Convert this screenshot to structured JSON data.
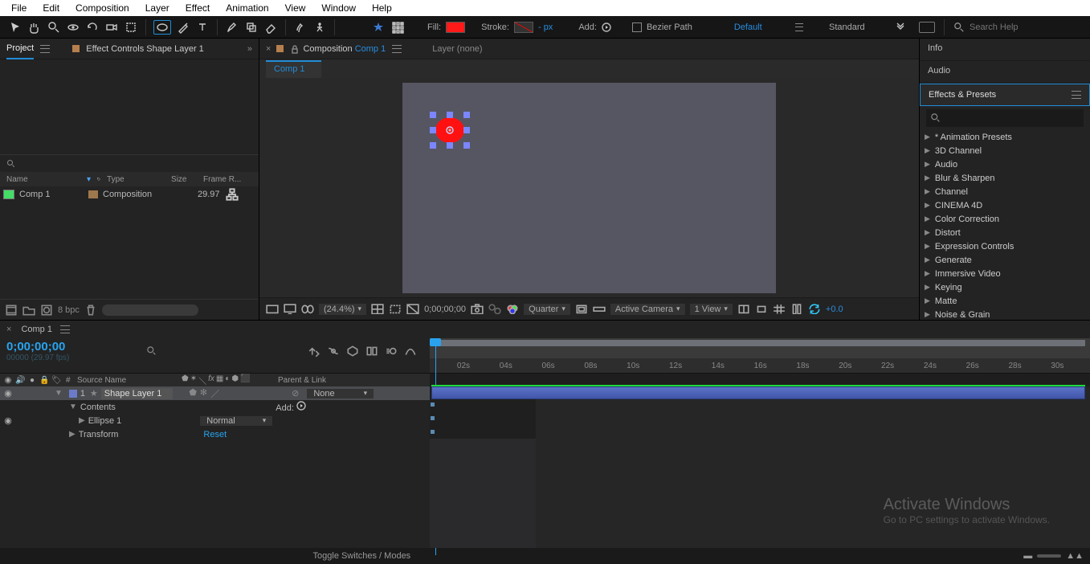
{
  "menubar": [
    "File",
    "Edit",
    "Composition",
    "Layer",
    "Effect",
    "Animation",
    "View",
    "Window",
    "Help"
  ],
  "toolbar": {
    "fill_label": "Fill:",
    "fill_color": "#ff1a1a",
    "stroke_label": "Stroke:",
    "stroke_px": "- px",
    "add_label": "Add:",
    "bezier_label": "Bezier Path",
    "workspace": "Default",
    "layout": "Standard",
    "search_placeholder": "Search Help"
  },
  "project_panel": {
    "title": "Project",
    "fx_tab": "Effect Controls Shape Layer 1",
    "columns": {
      "name": "Name",
      "type": "Type",
      "size": "Size",
      "frame": "Frame R..."
    },
    "item": {
      "name": "Comp 1",
      "type": "Composition",
      "fps": "29.97"
    },
    "bpc": "8 bpc"
  },
  "comp_panel": {
    "title": "Composition",
    "active": "Comp 1",
    "layer_tab": "Layer (none)",
    "tabitem": "Comp 1",
    "footer": {
      "zoom": "(24.4%)",
      "time": "0;00;00;00",
      "quality": "Quarter",
      "camera": "Active Camera",
      "view": "1 View",
      "exp": "+0.0"
    }
  },
  "right": {
    "info": "Info",
    "audio": "Audio",
    "fx_title": "Effects & Presets",
    "fx_items": [
      "* Animation Presets",
      "3D Channel",
      "Audio",
      "Blur & Sharpen",
      "Channel",
      "CINEMA 4D",
      "Color Correction",
      "Distort",
      "Expression Controls",
      "Generate",
      "Immersive Video",
      "Keying",
      "Matte",
      "Noise & Grain"
    ]
  },
  "timeline": {
    "tab": "Comp 1",
    "time": "0;00;00;00",
    "time_sub": "00000 (29.97 fps)",
    "cols": {
      "num": "#",
      "source": "Source Name",
      "parent": "Parent & Link"
    },
    "layer": {
      "num": "1",
      "name": "Shape Layer 1",
      "contents": "Contents",
      "add": "Add:",
      "ellipse": "Ellipse 1",
      "normal": "Normal",
      "transform": "Transform",
      "reset": "Reset",
      "none": "None"
    },
    "ruler": [
      "02s",
      "04s",
      "06s",
      "08s",
      "10s",
      "12s",
      "14s",
      "16s",
      "18s",
      "20s",
      "22s",
      "24s",
      "26s",
      "28s",
      "30s"
    ],
    "footer": "Toggle Switches / Modes"
  },
  "watermark": {
    "title": "Activate Windows",
    "sub": "Go to PC settings to activate Windows."
  }
}
